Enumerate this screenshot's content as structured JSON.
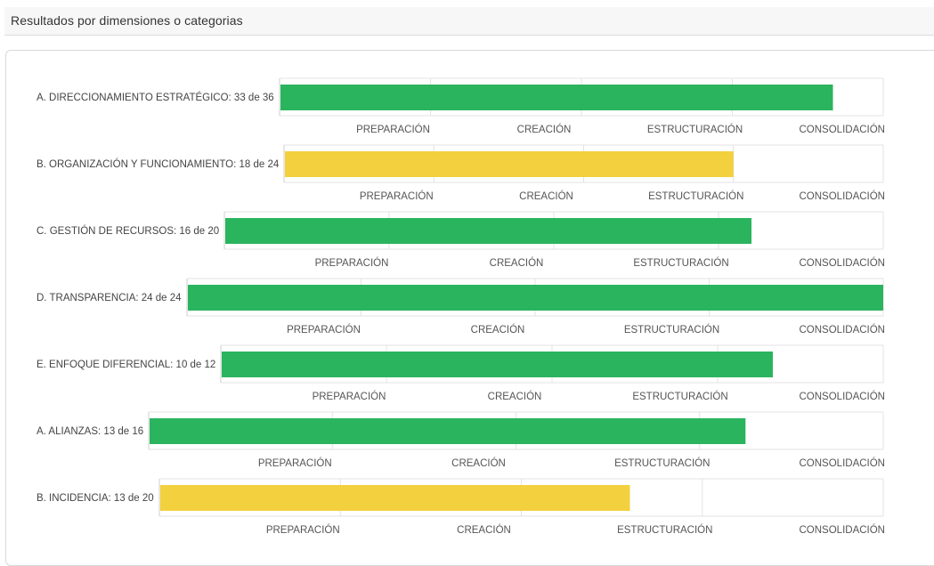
{
  "panel": {
    "title": "Resultados por dimensiones o categorias"
  },
  "colors": {
    "high": "#2ab45e",
    "medium": "#f3d03e",
    "grid": "#e3e3e3",
    "label": "#444444",
    "tick": "#555555"
  },
  "chart_data": {
    "type": "bar",
    "orientation": "horizontal",
    "stage_labels": [
      "PREPARACIÓN",
      "CREACIÓN",
      "ESTRUCTURACIÓN",
      "CONSOLIDACIÓN"
    ],
    "rows": [
      {
        "label": "A. DIRECCIONAMIENTO ESTRATÉGICO: 33 de 36",
        "score": 33,
        "max": 36,
        "color": "#2ab45e"
      },
      {
        "label": "B. ORGANIZACIÓN Y FUNCIONAMIENTO: 18 de 24",
        "score": 18,
        "max": 24,
        "color": "#f3d03e"
      },
      {
        "label": "C. GESTIÓN DE RECURSOS: 16 de 20",
        "score": 16,
        "max": 20,
        "color": "#2ab45e"
      },
      {
        "label": "D. TRANSPARENCIA: 24 de 24",
        "score": 24,
        "max": 24,
        "color": "#2ab45e"
      },
      {
        "label": "E. ENFOQUE DIFERENCIAL: 10 de 12",
        "score": 10,
        "max": 12,
        "color": "#2ab45e"
      },
      {
        "label": "A. ALIANZAS: 13 de 16",
        "score": 13,
        "max": 16,
        "color": "#2ab45e"
      },
      {
        "label": "B. INCIDENCIA: 13 de 20",
        "score": 13,
        "max": 20,
        "color": "#f3d03e"
      }
    ]
  }
}
